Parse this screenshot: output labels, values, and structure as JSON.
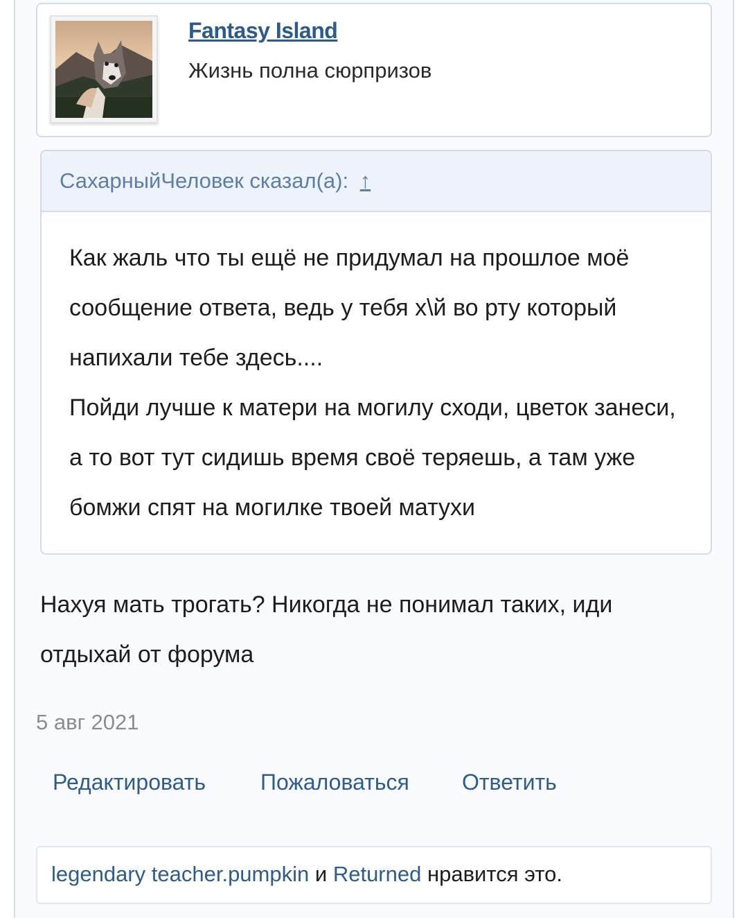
{
  "author": {
    "name": "Fantasy Island",
    "status": "Жизнь полна сюрпризов",
    "avatar_alt": "dog-avatar"
  },
  "quote": {
    "author_line": "СахарныйЧеловек сказал(а):",
    "jump_arrow": "↑",
    "text": "Как жаль что ты ещё не придумал на прошлое моё сообщение ответа, ведь у тебя х\\й во рту который напихали тебе здесь....\nПойди лучше к матери на могилу сходи, цветок занеси, а то вот тут сидишь время своё теряешь, а там уже бомжи спят на могилке твоей матухи"
  },
  "post": {
    "text": "Нахуя мать трогать? Никогда не понимал таких, иди отдыхай от форума",
    "date": "5 авг 2021"
  },
  "actions": {
    "edit": "Редактировать",
    "report": "Пожаловаться",
    "reply": "Ответить"
  },
  "likes": {
    "user1": "legendary teacher.pumpkin",
    "conjunction": "и",
    "user2": "Returned",
    "suffix": "нравится это."
  },
  "colors": {
    "link": "#2d5c8e",
    "quote_header_bg": "#eef2fa",
    "border": "#d3dbe8"
  }
}
